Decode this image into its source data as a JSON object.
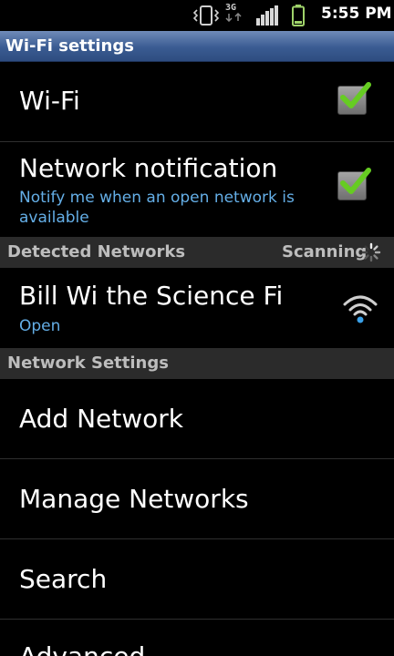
{
  "status_bar": {
    "network_type": "3G",
    "time": "5:55 PM",
    "icons": [
      "vibrate-icon",
      "3g-icon",
      "signal-icon",
      "battery-icon"
    ]
  },
  "title": "Wi-Fi settings",
  "wifi": {
    "label": "Wi-Fi",
    "checked": true
  },
  "network_notification": {
    "label": "Network notification",
    "summary": "Notify me when an open network is available",
    "checked": true
  },
  "detected_networks": {
    "header": "Detected Networks",
    "status": "Scanning",
    "networks": [
      {
        "ssid": "Bill Wi the Science Fi",
        "security": "Open",
        "icon": "wifi-signal-icon"
      }
    ]
  },
  "network_settings": {
    "header": "Network Settings",
    "items": [
      "Add Network",
      "Manage Networks",
      "Search",
      "Advanced"
    ]
  },
  "colors": {
    "accent_blue": "#64aee6",
    "title_bar": "#3a5b92",
    "check_green": "#66cc22",
    "section_bg": "#2b2b2b"
  }
}
